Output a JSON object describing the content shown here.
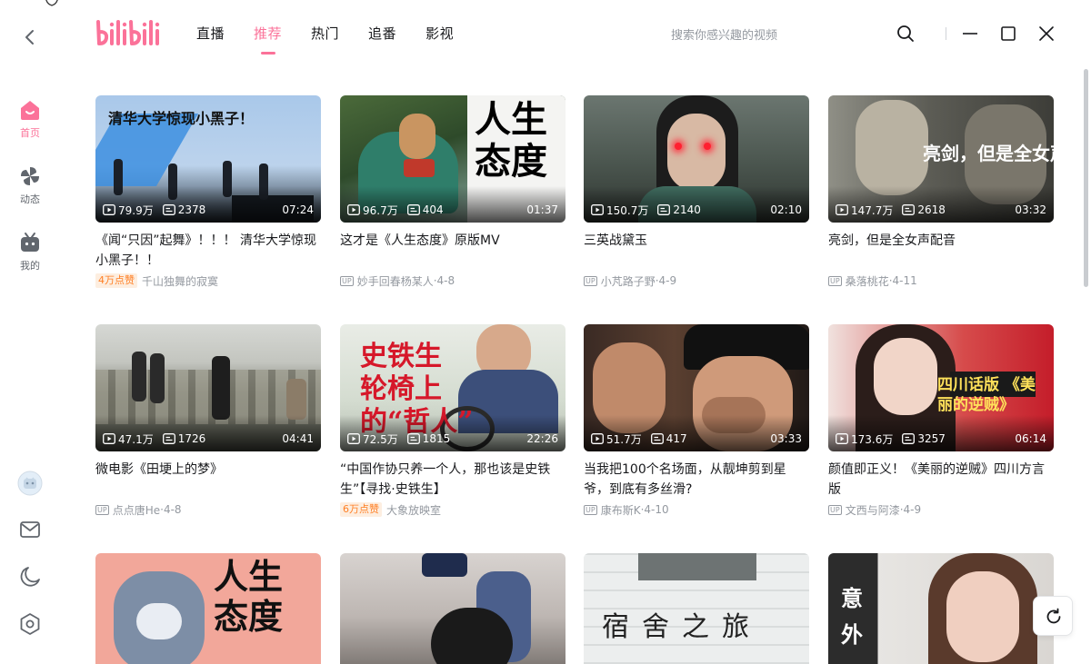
{
  "app": {
    "logo_text": "bilibili",
    "accent": "#fb7299"
  },
  "nav": {
    "tabs": [
      {
        "label": "直播",
        "active": false
      },
      {
        "label": "推荐",
        "active": true
      },
      {
        "label": "热门",
        "active": false
      },
      {
        "label": "追番",
        "active": false
      },
      {
        "label": "影视",
        "active": false
      }
    ]
  },
  "search": {
    "placeholder": "搜索你感兴趣的视频"
  },
  "sidebar": {
    "items": [
      {
        "label": "首页",
        "icon": "home-icon",
        "active": true
      },
      {
        "label": "动态",
        "icon": "pinwheel-icon",
        "active": false
      },
      {
        "label": "我的",
        "icon": "tv-icon",
        "active": false
      }
    ],
    "bottom_icons": [
      "avatar",
      "mail-icon",
      "moon-icon",
      "settings-icon"
    ]
  },
  "cards": [
    {
      "views": "79.9万",
      "danmaku": "2378",
      "duration": "07:24",
      "title": "《闻“只因”起舞》！！！ 清华大学惊现小黑子！！",
      "badge": "4万点赞",
      "author": "千山独舞的寂寞",
      "date": "",
      "thumb_text": "清华大学惊现小黑子！"
    },
    {
      "views": "96.7万",
      "danmaku": "404",
      "duration": "01:37",
      "title": "这才是《人生态度》原版MV",
      "badge": "",
      "author": "妙手回春杨某人",
      "date": "4-8",
      "thumb_text": "人生态度"
    },
    {
      "views": "150.7万",
      "danmaku": "2140",
      "duration": "02:10",
      "title": "三英战黛玉",
      "badge": "",
      "author": "小芃路子野",
      "date": "4-9",
      "thumb_text": ""
    },
    {
      "views": "147.7万",
      "danmaku": "2618",
      "duration": "03:32",
      "title": "亮剑，但是全女声配音",
      "badge": "",
      "author": "桑落桃花",
      "date": "4-11",
      "thumb_text": "亮剑，但是全女声配音"
    },
    {
      "views": "47.1万",
      "danmaku": "1726",
      "duration": "04:41",
      "title": "微电影《田埂上的梦》",
      "badge": "",
      "author": "点点唐He",
      "date": "4-8",
      "thumb_text": ""
    },
    {
      "views": "72.5万",
      "danmaku": "1815",
      "duration": "22:26",
      "title": "“中国作协只养一个人，那也该是史铁生”【寻找·史铁生】",
      "badge": "6万点赞",
      "author": "大象放映室",
      "date": "",
      "thumb_text": "史铁生 轮椅上的“哲人”"
    },
    {
      "views": "51.7万",
      "danmaku": "417",
      "duration": "03:33",
      "title": "当我把100个名场面，从靓坤剪到星爷，到底有多丝滑?",
      "badge": "",
      "author": "康布斯K",
      "date": "4-10",
      "thumb_text": ""
    },
    {
      "views": "173.6万",
      "danmaku": "3257",
      "duration": "06:14",
      "title": "颜值即正义！《美丽的逆贼》四川方言版",
      "badge": "",
      "author": "文西与阿漆",
      "date": "4-9",
      "thumb_text": "四川话版 《美丽的逆贼》"
    },
    {
      "views": "",
      "danmaku": "",
      "duration": "",
      "title": "",
      "badge": "",
      "author": "",
      "date": "",
      "thumb_text": "人生态度"
    },
    {
      "views": "",
      "danmaku": "",
      "duration": "",
      "title": "",
      "badge": "",
      "author": "",
      "date": "",
      "thumb_text": ""
    },
    {
      "views": "",
      "danmaku": "",
      "duration": "",
      "title": "",
      "badge": "",
      "author": "",
      "date": "",
      "thumb_text": "宿舍之旅"
    },
    {
      "views": "",
      "danmaku": "",
      "duration": "",
      "title": "",
      "badge": "",
      "author": "",
      "date": "",
      "thumb_text": "意外"
    }
  ],
  "up_tag": "UP",
  "date_sep": " · "
}
